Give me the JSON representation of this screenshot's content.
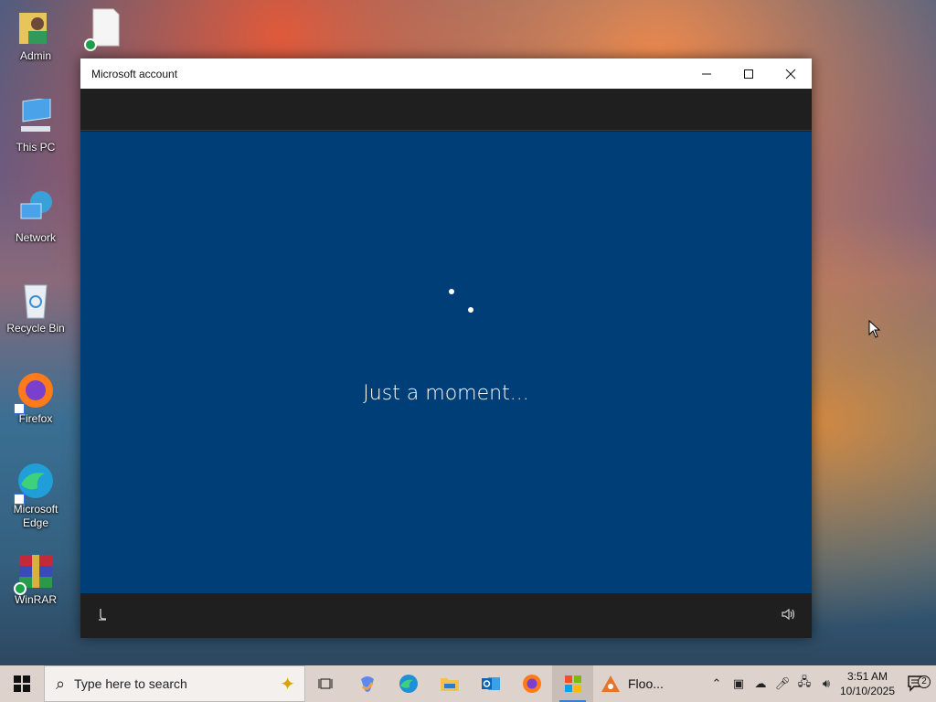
{
  "desktop": {
    "icons": [
      {
        "label": "Admin"
      },
      {
        "label": "This PC"
      },
      {
        "label": "Network"
      },
      {
        "label": "Recycle Bin"
      },
      {
        "label": "Firefox"
      },
      {
        "label": "Microsoft Edge"
      },
      {
        "label": "WinRAR"
      }
    ]
  },
  "window": {
    "title": "Microsoft account",
    "loading_text": "Just a moment..."
  },
  "taskbar": {
    "search_placeholder": "Type here to search",
    "apps": [
      {
        "icon": "task-view-icon"
      },
      {
        "icon": "copilot-icon"
      },
      {
        "icon": "edge-icon"
      },
      {
        "icon": "file-explorer-icon"
      },
      {
        "icon": "outlook-icon"
      },
      {
        "icon": "firefox-icon"
      },
      {
        "icon": "microsoft-store-icon"
      },
      {
        "icon": "floorp-icon",
        "label": "Floo..."
      }
    ],
    "clock_time": "3:51 AM",
    "clock_date": "10/10/2025",
    "notification_count": "2"
  },
  "colors": {
    "content_background": "#003e78",
    "window_chrome": "#1f1f1f",
    "taskbar_background": "#ddd3cc"
  }
}
